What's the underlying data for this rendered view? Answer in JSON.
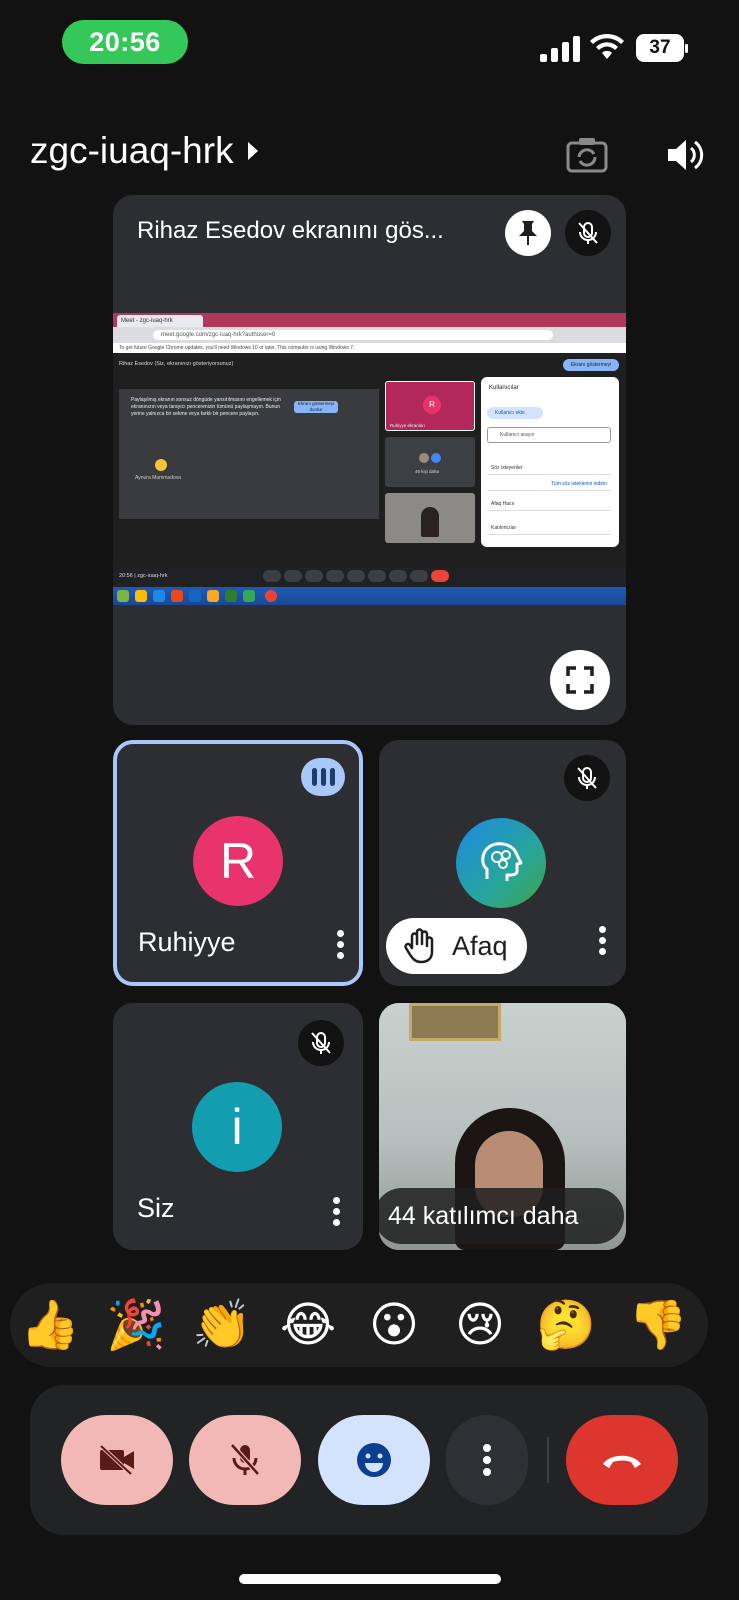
{
  "status_bar": {
    "time": "20:56",
    "battery": "37"
  },
  "header": {
    "meeting_code": "zgc-iuaq-hrk"
  },
  "presentation": {
    "title": "Rihaz Esedov ekranını gös...",
    "screen": {
      "tab_title": "Meet - zgc-iuaq-hrk",
      "url": "meet.google.com/zgc-iuaq-hrk?authuser=0",
      "info_bar": "To get future Google Chrome updates, you'll need Windows 10 or later. This computer is using Windows 7.",
      "meet_header": "Rihaz Esedov (Siz, ekranınızı gösteriyorsunuz)",
      "stop_button": "Ekranı göstermeyi durdur",
      "share_text": "Paylaşılmış ekranın sonsuz döngüde yansıtılmasını engellemek için ekranınızın veya tarayıcı pencerenizin tümünü paylaşmayın. Bunun yerine yalnızca bir sekme veya farklı bir pencere paylaşın.",
      "share_button": "Ekranı göstermeyi durdur",
      "mini_participant": "Aynura Mammadova",
      "mini_r_label": "Ruhiyye ekranları",
      "mini_2_label": "46 kişi daha",
      "panel_title": "Kullanıcılar",
      "panel_add": "Kullanıcı ekle",
      "panel_search": "Kullanıcı arayın",
      "panel_rows": [
        "Söz isteyenler",
        "Tüm söz isteklerini indirin",
        "Afaq Hacıı",
        "Katılımcılar"
      ],
      "bottom_label": "20:56 | zgc-iuaq-hrk"
    }
  },
  "participants": [
    {
      "name": "Ruhiyye",
      "initial": "R",
      "color": "#e8336d",
      "speaking": true
    },
    {
      "name": "Afaq",
      "avatar_icon": "brain-icon",
      "hand_raised": true,
      "muted": true
    },
    {
      "name": "Siz",
      "initial": "i",
      "color": "#129eaf",
      "muted": true
    },
    {
      "more_label": "44 katılımcı daha"
    }
  ],
  "reactions": [
    "👍",
    "🎉",
    "👏",
    "😂",
    "😮",
    "😢",
    "🤔",
    "👎"
  ],
  "controls": [
    {
      "name": "camera",
      "icon": "camera-off-icon",
      "state": "off"
    },
    {
      "name": "microphone",
      "icon": "mic-off-icon",
      "state": "off"
    },
    {
      "name": "reactions",
      "icon": "smile-icon"
    },
    {
      "name": "more",
      "icon": "more-vert-icon"
    },
    {
      "name": "end-call",
      "icon": "call-end-icon"
    }
  ],
  "colors": {
    "accent": "#a8c7fa",
    "end_call": "#dc362e",
    "muted_bg": "#f2b8b5",
    "time_pill": "#34c759"
  }
}
